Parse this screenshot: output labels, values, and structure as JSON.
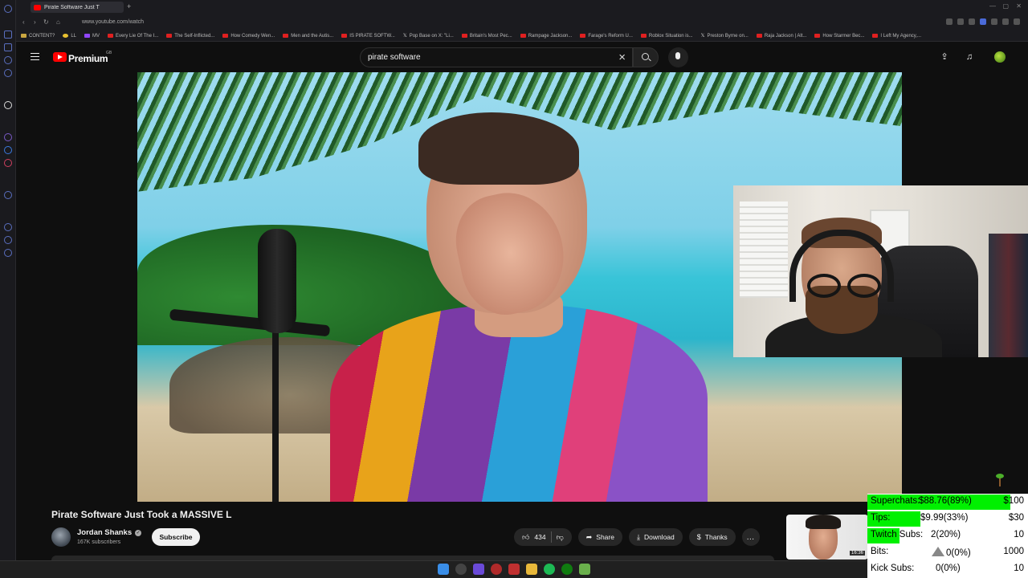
{
  "browser": {
    "tab_title": "Pirate Software Just T",
    "url": "www.youtube.com/watch",
    "bookmarks": [
      {
        "label": "CONTENT?",
        "icon": "folder-icon"
      },
      {
        "label": "LL",
        "icon": "globe-icon"
      },
      {
        "label": "MV",
        "icon": "twitch-icon"
      },
      {
        "label": "Every Lie Of The I...",
        "icon": "youtube-icon"
      },
      {
        "label": "The Self-Inflicted...",
        "icon": "youtube-icon"
      },
      {
        "label": "How Comedy Wen...",
        "icon": "youtube-icon"
      },
      {
        "label": "Men and the Autis...",
        "icon": "youtube-icon"
      },
      {
        "label": "IS PIRATE SOFTW...",
        "icon": "youtube-icon"
      },
      {
        "label": "Pop Base on X: \"Li...",
        "icon": "x-icon"
      },
      {
        "label": "Britain's Most Pec...",
        "icon": "youtube-icon"
      },
      {
        "label": "Rampage Jackson...",
        "icon": "youtube-icon"
      },
      {
        "label": "Farage's Reform U...",
        "icon": "youtube-icon"
      },
      {
        "label": "Roblox Situation is...",
        "icon": "youtube-icon"
      },
      {
        "label": "Preston Byrne on...",
        "icon": "x-icon"
      },
      {
        "label": "Raja Jackson | Alt...",
        "icon": "youtube-icon"
      },
      {
        "label": "How Starmer Bec...",
        "icon": "youtube-icon"
      },
      {
        "label": "I Left My Agency,...",
        "icon": "youtube-icon"
      }
    ]
  },
  "youtube": {
    "brand": "Premium",
    "region": "GB",
    "search": {
      "value": "pirate software"
    },
    "icons": {
      "menu": "hamburger-icon",
      "upload": "upload-icon",
      "notifications": "bell-icon"
    }
  },
  "video": {
    "title": "Pirate Software Just Took a MASSIVE L",
    "channel": "Jordan Shanks",
    "subscribers": "167K subscribers",
    "subscribe_label": "Subscribe",
    "likes": "434",
    "share_label": "Share",
    "download_label": "Download",
    "thanks_label": "Thanks",
    "more_label": "...",
    "next_thumb_duration": "16:36"
  },
  "stream_goals": [
    {
      "label": "Superchats:",
      "value": "$88.76(89%)",
      "target": "$100",
      "progress": 0.89
    },
    {
      "label": "Tips:",
      "value": "$9.99(33%)",
      "target": "$30",
      "progress": 0.33
    },
    {
      "label": "Twitch Subs:",
      "value": "2(20%)",
      "target": "10",
      "progress": 0.2
    },
    {
      "label": "Bits:",
      "value": "0(0%)",
      "target": "1000",
      "progress": 0.0,
      "icon": "triangle-icon"
    },
    {
      "label": "Kick Subs:",
      "value": "0(0%)",
      "target": "10",
      "progress": 0.0
    }
  ],
  "colors": {
    "accent_red": "#ff0000",
    "goal_fill": "#00f000",
    "background": "#0f0f0f"
  }
}
